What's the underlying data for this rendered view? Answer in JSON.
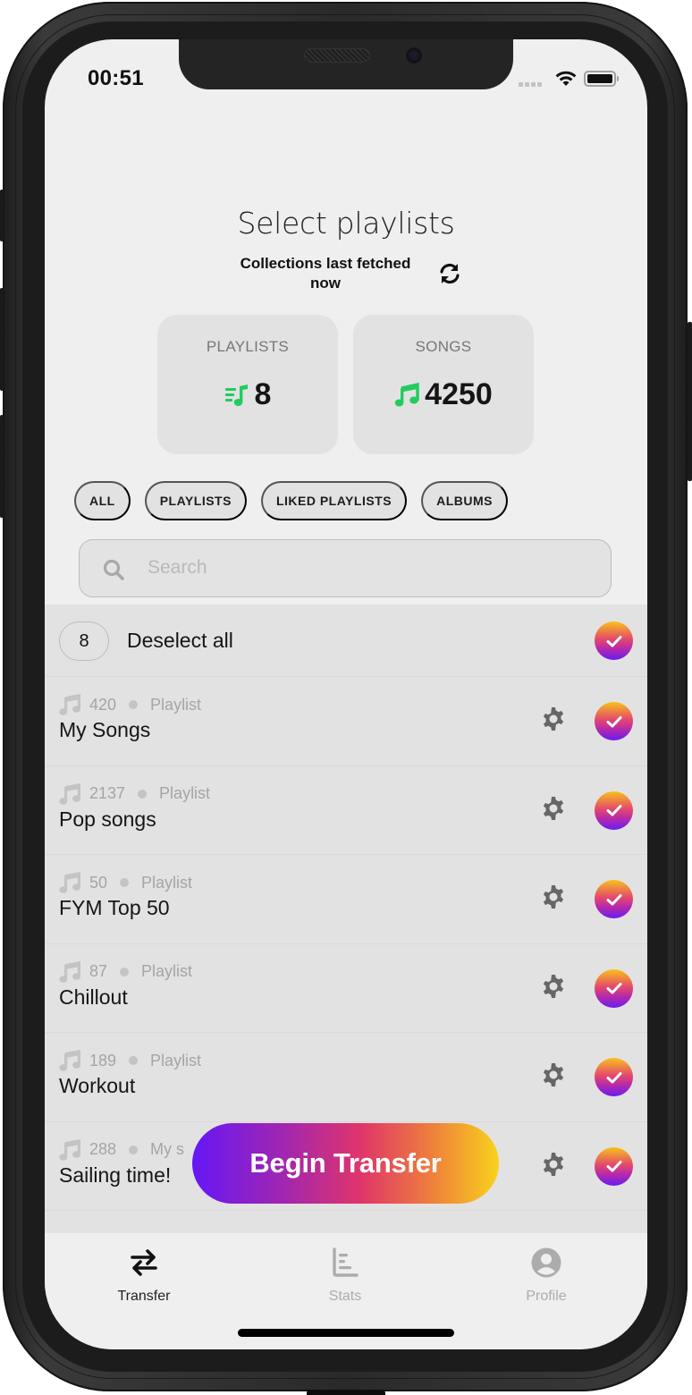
{
  "status_bar": {
    "time": "00:51"
  },
  "header": {
    "title": "Select playlists",
    "fetched_line1": "Collections last fetched",
    "fetched_line2": "now"
  },
  "stats": {
    "playlists_label": "PLAYLISTS",
    "playlists_value": "8",
    "songs_label": "SONGS",
    "songs_value": "4250",
    "accent_color": "#22cc5e"
  },
  "filters": [
    {
      "label": "ALL"
    },
    {
      "label": "PLAYLISTS"
    },
    {
      "label": "LIKED PLAYLISTS"
    },
    {
      "label": "ALBUMS"
    }
  ],
  "search": {
    "placeholder": "Search",
    "value": ""
  },
  "selection": {
    "count": "8",
    "deselect_label": "Deselect all",
    "selected": true
  },
  "playlists": [
    {
      "count": "420",
      "type": "Playlist",
      "name": "My Songs",
      "selected": true
    },
    {
      "count": "2137",
      "type": "Playlist",
      "name": "Pop songs",
      "selected": true
    },
    {
      "count": "50",
      "type": "Playlist",
      "name": "FYM Top 50",
      "selected": true
    },
    {
      "count": "87",
      "type": "Playlist",
      "name": "Chillout",
      "selected": true
    },
    {
      "count": "189",
      "type": "Playlist",
      "name": "Workout",
      "selected": true
    },
    {
      "count": "288",
      "type": "My s",
      "name": "Sailing time!",
      "selected": true
    }
  ],
  "cta": {
    "label": "Begin Transfer",
    "gradient": [
      "#6617f6",
      "#e0356a",
      "#f9d21c"
    ]
  },
  "tabbar": {
    "items": [
      {
        "label": "Transfer",
        "icon": "transfer-arrows-icon",
        "active": true
      },
      {
        "label": "Stats",
        "icon": "stats-chart-icon",
        "active": false
      },
      {
        "label": "Profile",
        "icon": "user-circle-icon",
        "active": false
      }
    ]
  }
}
